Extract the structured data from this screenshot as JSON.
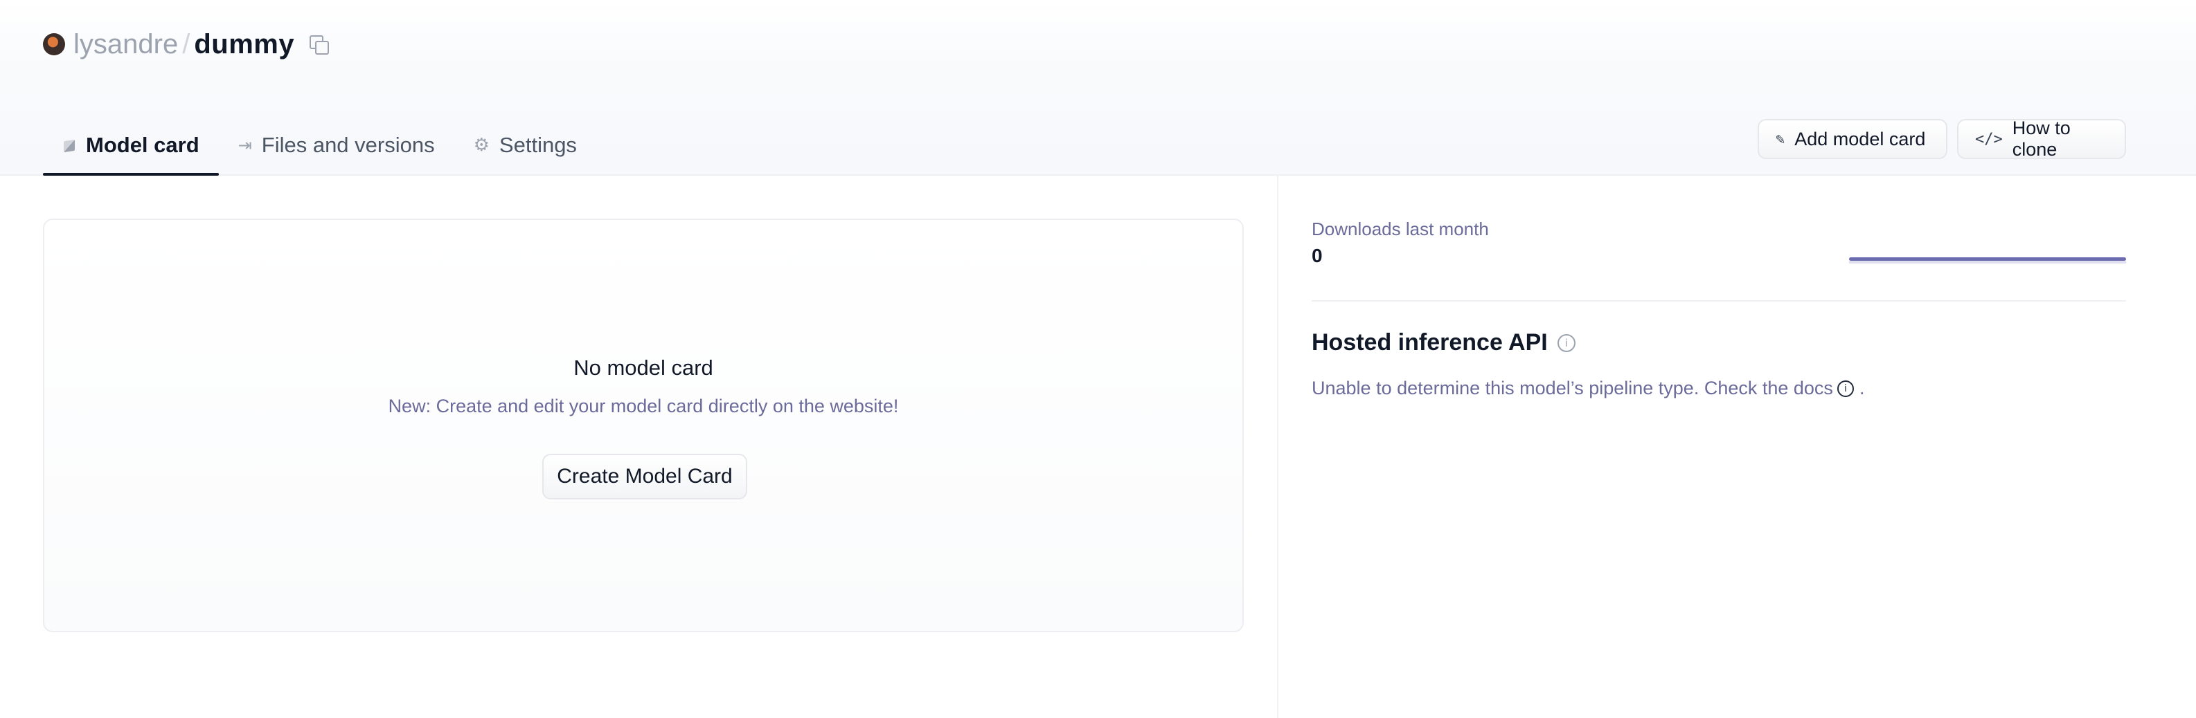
{
  "repo": {
    "owner": "lysandre",
    "separator": "/",
    "name": "dummy"
  },
  "tabs": [
    {
      "label": "Model card",
      "icon": "cube-icon",
      "active": true
    },
    {
      "label": "Files and versions",
      "icon": "files-icon",
      "active": false
    },
    {
      "label": "Settings",
      "icon": "gear-icon",
      "active": false
    }
  ],
  "actions": {
    "add_model_card": "Add model card",
    "how_to_clone": "How to clone"
  },
  "model_card": {
    "title": "No model card",
    "subtitle": "New: Create and edit your model card directly on the website!",
    "create_button": "Create Model Card"
  },
  "sidebar": {
    "downloads_label": "Downloads last month",
    "downloads_value": "0",
    "inference_title": "Hosted inference API",
    "inference_text": "Unable to determine this model’s pipeline type. Check the docs",
    "inference_text_end": "."
  },
  "colors": {
    "accent": "#6b6bb0",
    "muted_text": "#6b6b9a"
  }
}
